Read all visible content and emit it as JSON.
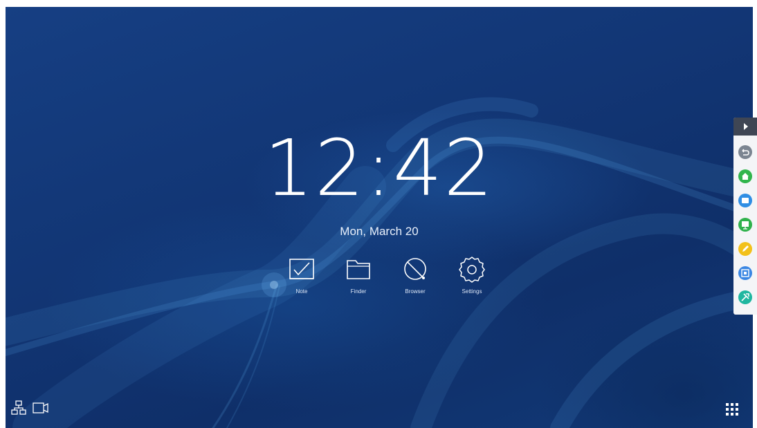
{
  "clock": {
    "time": "12:42",
    "date": "Mon, March 20"
  },
  "apps": [
    {
      "label": "Note",
      "icon": "note-icon"
    },
    {
      "label": "Finder",
      "icon": "folder-icon"
    },
    {
      "label": "Browser",
      "icon": "browser-icon"
    },
    {
      "label": "Settings",
      "icon": "gear-icon"
    }
  ],
  "status_bar": {
    "left_icons": [
      "network-icon",
      "screen-cast-icon"
    ],
    "right_icon": "app-grid-icon"
  },
  "sidebar": {
    "toggle_icon": "expand-arrow-icon",
    "tools": [
      {
        "icon": "back-icon",
        "color": "#7b8591"
      },
      {
        "icon": "home-icon",
        "color": "#31b54c"
      },
      {
        "icon": "window-icon",
        "color": "#2f8ee4"
      },
      {
        "icon": "whiteboard-icon",
        "color": "#2fb24c"
      },
      {
        "icon": "annotate-pen-icon",
        "color": "#f2c11b"
      },
      {
        "icon": "screenshot-icon",
        "color": "#3a87e3"
      },
      {
        "icon": "tools-icon",
        "color": "#1fb7a0"
      }
    ]
  },
  "colors": {
    "background": "#133775",
    "sidebar": "#f4f5f7",
    "sidebar_toggle": "#3f4654"
  }
}
